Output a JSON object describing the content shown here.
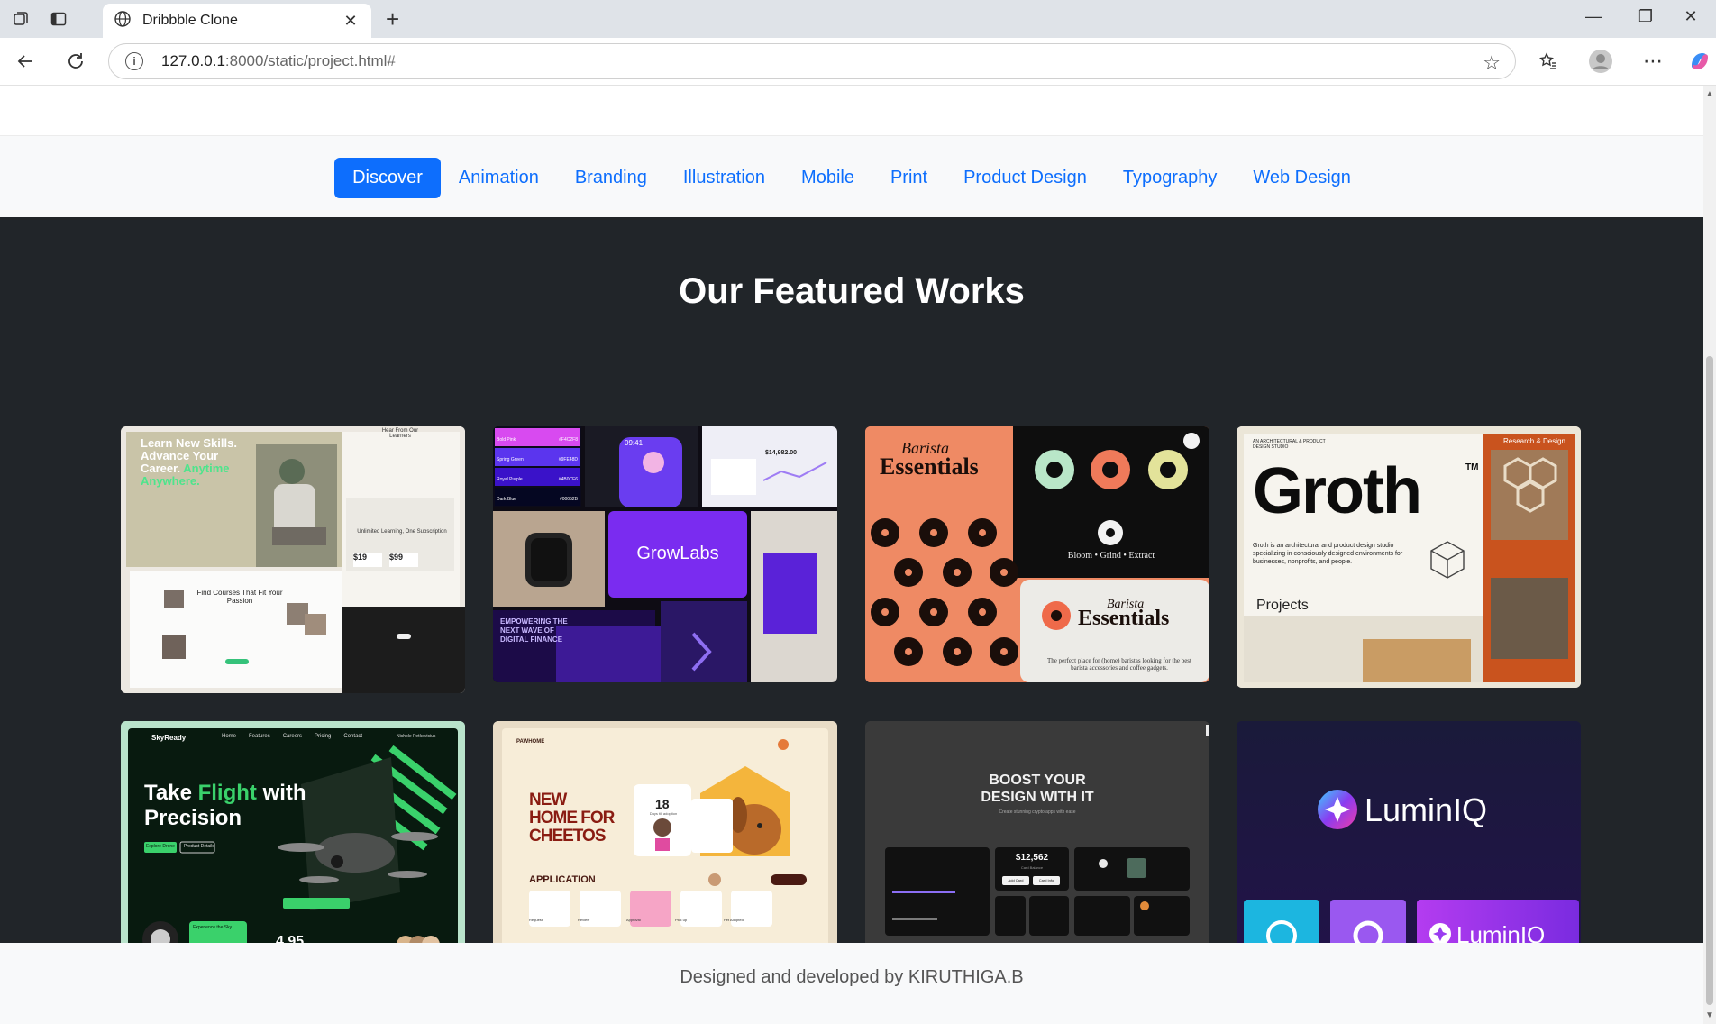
{
  "browser": {
    "tab_title": "Dribbble Clone",
    "url_host": "127.0.0.1",
    "url_rest": ":8000/static/project.html#"
  },
  "categories": [
    {
      "label": "Discover",
      "active": true
    },
    {
      "label": "Animation",
      "active": false
    },
    {
      "label": "Branding",
      "active": false
    },
    {
      "label": "Illustration",
      "active": false
    },
    {
      "label": "Mobile",
      "active": false
    },
    {
      "label": "Print",
      "active": false
    },
    {
      "label": "Product Design",
      "active": false
    },
    {
      "label": "Typography",
      "active": false
    },
    {
      "label": "Web Design",
      "active": false
    }
  ],
  "featured": {
    "title": "Our Featured Works",
    "cards": [
      {
        "headline_lines": [
          "Learn New Skills.",
          "Advance Your",
          "Career."
        ],
        "headline_accent": "Anytime Anywhere.",
        "side_title": "Hear From Our Learners",
        "sub_title": "Find Courses That Fit Your Passion",
        "plan_title": "Unlimited Learning, One Subscription",
        "price_a": "$19",
        "price_b": "$99"
      },
      {
        "brand": "GrowLabs",
        "time": "09:41",
        "swatches": [
          {
            "name": "Bold Pink",
            "hex": "#F4C2F8"
          },
          {
            "name": "Spring Green",
            "hex": "#9FE48D"
          },
          {
            "name": "Royal Purple",
            "hex": "#4B0CF6"
          },
          {
            "name": "Dark Blue",
            "hex": "#00052B"
          }
        ],
        "slogan": "EMPOWERING THE NEXT WAVE OF DIGITAL FINANCE",
        "amount": "$14,982.00"
      },
      {
        "brand_script": "Barista",
        "brand_main": "Essentials",
        "tagline": "Bloom • Grind • Extract",
        "blurb": "The perfect place for (home) baristas looking for the best barista accessories and coffee gadgets."
      },
      {
        "brand": "Groth",
        "tm": "TM",
        "kicker": "AN ARCHITECTURAL & PRODUCT DESIGN STUDIO",
        "description": "Groth is an architectural and product design studio specializing in consciously designed environments for businesses, nonprofits, and people.",
        "projects_label": "Projects",
        "side_label": "Research & Design"
      },
      {
        "brand": "SkyReady",
        "nav": [
          "Home",
          "Features",
          "Careers",
          "Pricing",
          "Contact"
        ],
        "user": "Nichole Petkevicius",
        "headline_pre": "Take ",
        "headline_accent": "Flight",
        "headline_post": " with",
        "headline_line2": "Precision",
        "cta_primary": "Explore Drone",
        "cta_secondary": "Product Details",
        "rating": "4.95",
        "promo": "Experience the Sky"
      },
      {
        "brand": "PAWHOME",
        "headline_lines": [
          "NEW",
          "HOME FOR",
          "CHEETOS"
        ],
        "days": "18",
        "days_label": "Days till adoption",
        "section": "APPLICATION",
        "steps": [
          "Request",
          "Review",
          "Approval",
          "Pick up",
          "Pet Adopted"
        ]
      },
      {
        "headline_lines": [
          "BOOST YOUR",
          "DESIGN WITH IT"
        ],
        "subtitle": "Create stunning crypto apps with ease",
        "amount": "$12,562",
        "amount_label": "Card Balance",
        "btn_a": "Add Card",
        "btn_b": "Card Info"
      },
      {
        "brand": "LuminIQ",
        "brand_small": "LuminIQ"
      }
    ]
  },
  "footer": {
    "text": "Designed and developed by KIRUTHIGA.B"
  },
  "colors": {
    "primary": "#0d6efd",
    "dark_section": "#212529",
    "nav_bg": "#f8f9fa"
  }
}
